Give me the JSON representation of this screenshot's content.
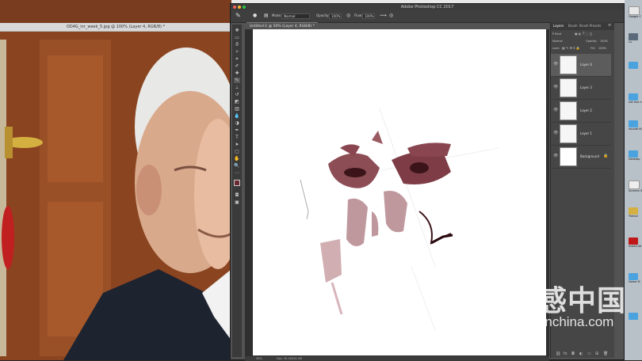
{
  "left_window": {
    "title": "OD4G_inr_week_5.jpg @ 100% (Layer 4, RGB/8) *"
  },
  "photoshop": {
    "window_title": "Adobe Photoshop CC 2017",
    "options_bar": {
      "mode_label": "Mode:",
      "mode_value": "Normal",
      "opacity_label": "Opacity:",
      "opacity_value": "100%",
      "flow_label": "Flow:",
      "flow_value": "100%"
    },
    "document_tab": "Untitled-1 @ 50% (Layer 4, RGB/8) *",
    "status_bar": {
      "zoom": "50%",
      "doc_info": "Doc: 30.1M/34.2M"
    },
    "panel": {
      "tabs": [
        "Layers",
        "Brush",
        "Brush Presets"
      ],
      "kind_label": "P Kind",
      "blend_mode": "Normal",
      "opacity_label": "Opacity:",
      "opacity_value": "100%",
      "lock_label": "Lock:",
      "fill_label": "Fill:",
      "fill_value": "100%",
      "layers": [
        {
          "name": "Layer 4"
        },
        {
          "name": "Layer 3"
        },
        {
          "name": "Layer 2"
        },
        {
          "name": "Layer 1"
        },
        {
          "name": "Background"
        }
      ]
    }
  },
  "desktop": {
    "items": [
      {
        "label": "Google C"
      },
      {
        "label": "Lu"
      },
      {
        "label": "not ava mach"
      },
      {
        "label": "recordi files 'BIT'"
      },
      {
        "label": "Desktop"
      },
      {
        "label": "Screens 03.36 Fr"
      },
      {
        "label": "Transcr"
      },
      {
        "label": "Install Ad Phot"
      },
      {
        "label": "Home M"
      }
    ]
  },
  "watermark": {
    "chinese": "灵感中国",
    "latin": "lingganchina.com"
  },
  "colors": {
    "ps_bg": "#535353",
    "door": "#8b4513",
    "accent": "#4aa3df"
  }
}
